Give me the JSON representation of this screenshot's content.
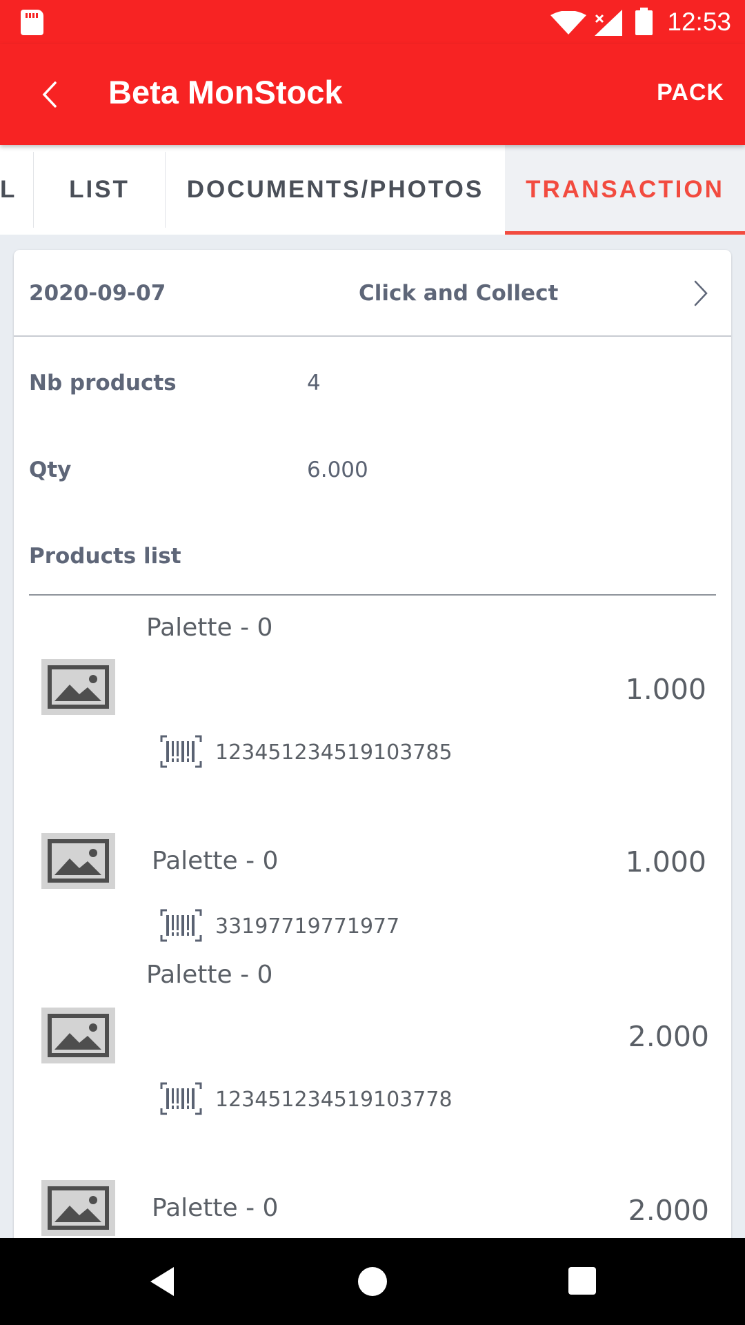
{
  "status_bar": {
    "time": "12:53",
    "icons": [
      "sd-card-icon",
      "wifi-icon",
      "signal-icon",
      "battery-icon"
    ]
  },
  "app_bar": {
    "back_icon": "chevron-left-icon",
    "title": "Beta MonStock",
    "action_label": "PACK"
  },
  "tabs": [
    {
      "label": "L",
      "active": false
    },
    {
      "label": "LIST",
      "active": false
    },
    {
      "label": "DOCUMENTS/PHOTOS",
      "active": false
    },
    {
      "label": "TRANSACTION",
      "active": true
    }
  ],
  "transaction": {
    "date": "2020-09-07",
    "type": "Click and Collect",
    "nb_products_label": "Nb products",
    "nb_products_value": "4",
    "qty_label": "Qty",
    "qty_value": "6.000",
    "products_list_label": "Products list"
  },
  "products": [
    {
      "name": "Palette - 0",
      "qty": "1.000",
      "barcode": "123451234519103785"
    },
    {
      "name": "Palette - 0",
      "qty": "1.000",
      "barcode": "33197719771977"
    },
    {
      "name": "Palette - 0",
      "qty": "2.000",
      "barcode": "123451234519103778"
    },
    {
      "name": "Palette - 0",
      "qty": "2.000",
      "barcode": ""
    }
  ],
  "colors": {
    "primary": "#F72323",
    "accent": "#F24B3F",
    "label_text": "#5E6678",
    "background": "#E9EDF2"
  }
}
